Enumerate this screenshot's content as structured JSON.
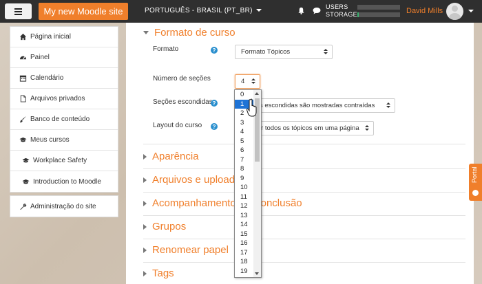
{
  "navbar": {
    "brand": "My new Moodle site",
    "language": "PORTUGUÊS - BRASIL (PT_BR)",
    "quota_users_label": "USERS",
    "quota_storage_label": "STORAGE",
    "quota_users_fraction": 0.0,
    "quota_storage_fraction": 0.03,
    "username": "David Mills",
    "accent_color": "#f07f2b"
  },
  "sidebar": {
    "items": [
      {
        "label": "Página inicial",
        "icon": "home-icon"
      },
      {
        "label": "Painel",
        "icon": "dashboard-icon"
      },
      {
        "label": "Calendário",
        "icon": "calendar-icon"
      },
      {
        "label": "Arquivos privados",
        "icon": "file-icon"
      },
      {
        "label": "Banco de conteúdo",
        "icon": "paintbrush-icon"
      },
      {
        "label": "Meus cursos",
        "icon": "graduation-cap-icon"
      },
      {
        "label": "Workplace Safety",
        "icon": "graduation-cap-icon"
      },
      {
        "label": "Introduction to Moodle",
        "icon": "graduation-cap-icon"
      }
    ],
    "admin": {
      "label": "Administração do site",
      "icon": "wrench-icon"
    }
  },
  "main": {
    "section_open": "Formato de curso",
    "format_label": "Formato",
    "format_value": "Formato Tópicos",
    "num_sections_label": "Número de seções",
    "num_sections_value": "4",
    "hidden_sections_label": "Seções escondidas",
    "hidden_sections_value": "Seções escondidas são mostradas contraídas",
    "layout_label": "Layout do curso",
    "layout_value": "Mostrar todos os tópicos em uma página",
    "collapsed_sections": [
      "Aparência",
      "Arquivos e uploads",
      "Acompanhamento de Conclusão",
      "Grupos",
      "Renomear papel",
      "Tags"
    ]
  },
  "dropdown": {
    "options": [
      "0",
      "1",
      "2",
      "3",
      "4",
      "5",
      "6",
      "7",
      "8",
      "9",
      "10",
      "11",
      "12",
      "13",
      "14",
      "15",
      "16",
      "17",
      "18",
      "19"
    ],
    "highlighted": "1"
  },
  "portal_tab": "Portal"
}
